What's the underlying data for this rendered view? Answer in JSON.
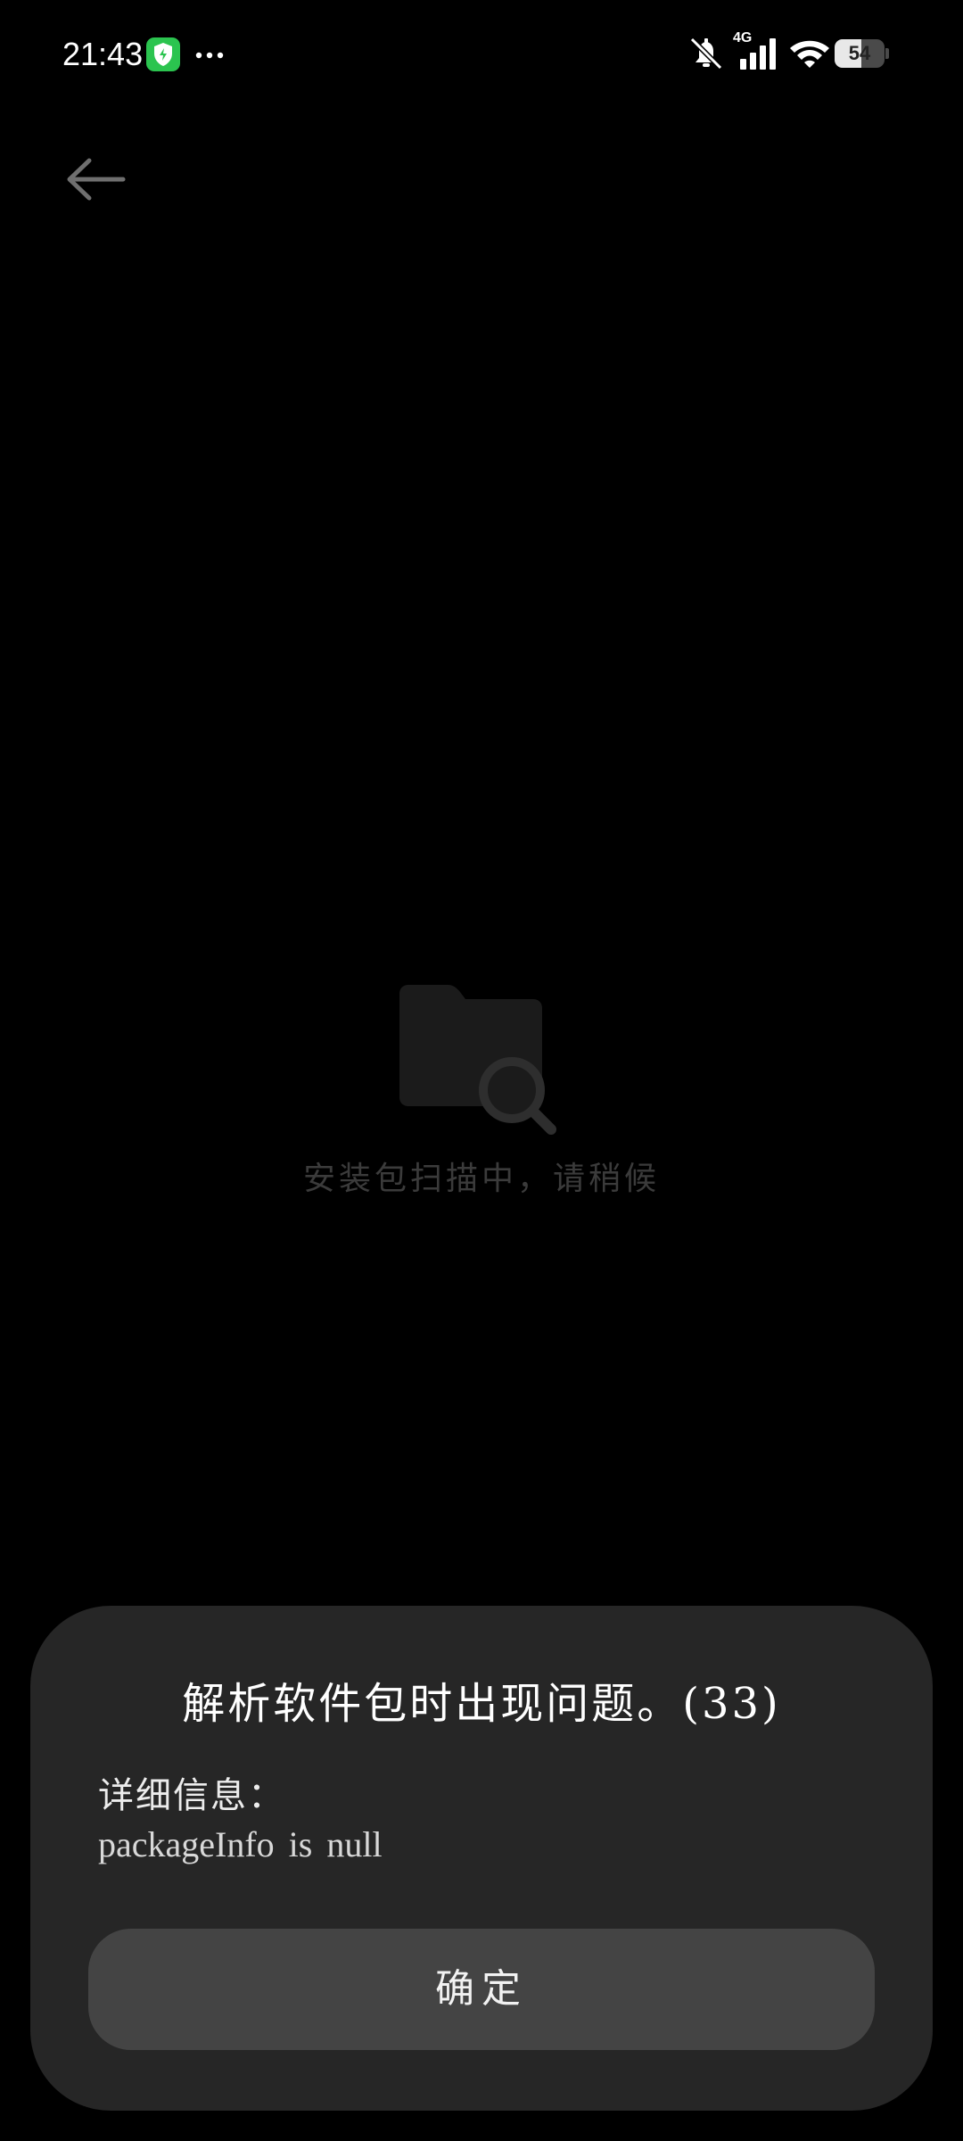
{
  "status_bar": {
    "time": "21:43",
    "network_label": "4G",
    "battery_level": "54",
    "battery_fraction": 0.54,
    "icons": {
      "app": "shield-icon",
      "more": "more-dots-icon",
      "mute": "bell-off-icon",
      "signal": "signal-bars-icon",
      "wifi": "wifi-icon",
      "battery": "battery-icon"
    }
  },
  "nav": {
    "back_icon": "back-arrow-icon"
  },
  "scan": {
    "icon": "folder-search-icon",
    "text": "安装包扫描中，请稍候"
  },
  "dialog": {
    "title": "解析软件包时出现问题。(33)",
    "detail_label": "详细信息：",
    "detail_text": "packageInfo is null",
    "confirm_label": "确定"
  },
  "colors": {
    "background": "#000000",
    "dialog_background": "#262626",
    "button_background": "#444444",
    "app_icon_green": "#2bc44f",
    "placeholder_gray": "#3b3b3b"
  }
}
